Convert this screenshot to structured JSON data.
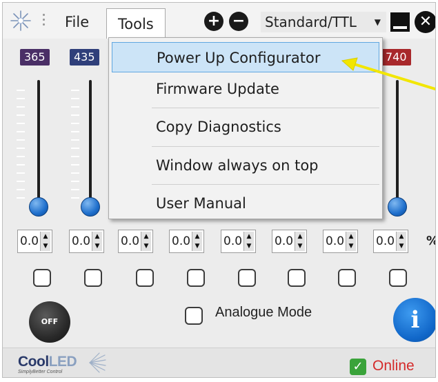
{
  "menubar": {
    "file_label": "File",
    "tools_label": "Tools",
    "plus_symbol": "+",
    "minus_symbol": "−",
    "mode_value": "Standard/TTL",
    "close_symbol": "✕"
  },
  "channels": [
    {
      "wavelength": "365",
      "badge_color": "#4a2f66",
      "intensity": "0.0"
    },
    {
      "wavelength": "435",
      "badge_color": "#2f3f7a",
      "intensity": "0.0"
    },
    {
      "wavelength": "",
      "badge_color": "",
      "intensity": "0.0"
    },
    {
      "wavelength": "",
      "badge_color": "",
      "intensity": "0.0"
    },
    {
      "wavelength": "",
      "badge_color": "",
      "intensity": "0.0"
    },
    {
      "wavelength": "",
      "badge_color": "",
      "intensity": "0.0"
    },
    {
      "wavelength": "",
      "badge_color": "",
      "intensity": "0.0"
    },
    {
      "wavelength": "740",
      "badge_color": "#a8282b",
      "intensity": "0.0"
    }
  ],
  "percent_label": "%",
  "tools_menu": {
    "items": [
      {
        "label": "Power Up Configurator",
        "highlighted": true
      },
      {
        "label": "Firmware Update",
        "highlighted": false
      },
      {
        "label": "Copy Diagnostics",
        "highlighted": false
      },
      {
        "label": "Window always on top",
        "highlighted": false
      },
      {
        "label": "User Manual",
        "highlighted": false
      }
    ]
  },
  "controls": {
    "off_label": "OFF",
    "analogue_label": "Analogue Mode",
    "info_label": "i"
  },
  "footer": {
    "brand_cool": "Cool",
    "brand_led": "LED",
    "brand_tagline": "SimplyBetter Control",
    "status_label": "Online",
    "status_icon": "✓"
  },
  "colors": {
    "accent_blue": "#1f6fcc",
    "online_red": "#d42a2a",
    "online_green": "#3aa33a",
    "annotation_yellow": "#f2e600"
  }
}
